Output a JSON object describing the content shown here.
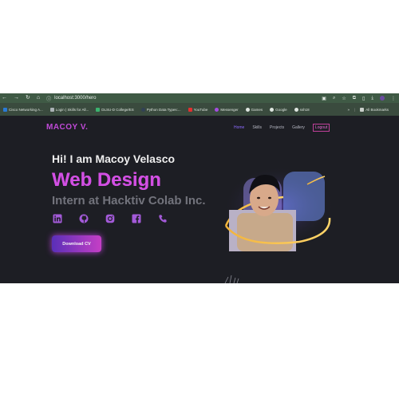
{
  "browser": {
    "url": "localhost:3000/hero",
    "bookmarks": [
      {
        "label": "Cisco Networking A...",
        "color": "#2a7bd6"
      },
      {
        "label": "Login | Skills for All...",
        "color": "#aab1b4"
      },
      {
        "label": "DLSU-D College/ES",
        "color": "#3bb36f"
      },
      {
        "label": "Python Data Types:...",
        "color": "#314155"
      },
      {
        "label": "YouTube",
        "color": "#e23030"
      },
      {
        "label": "Messenger",
        "color": "#a54de0"
      },
      {
        "label": "Games",
        "color": "#dfe6e0"
      },
      {
        "label": "Google",
        "color": "#dfe6e0"
      },
      {
        "label": "ssh18",
        "color": "#dfe6e0"
      }
    ],
    "all_bookmarks": "All Bookmarks",
    "more": "»"
  },
  "site": {
    "logo": "MACOY V.",
    "nav": [
      "Home",
      "Skills",
      "Projects",
      "Gallery",
      "Logout"
    ],
    "greeting": "Hi! I am Macoy Velasco",
    "role": "Web Design",
    "subtitle": "Intern at Hacktiv Colab Inc.",
    "cv_button": "Download CV",
    "socials": [
      "linkedin-icon",
      "github-icon",
      "instagram-icon",
      "facebook-icon",
      "phone-icon"
    ]
  },
  "colors": {
    "accent": "#c04ad8",
    "background": "#1d1e24",
    "nav_active": "#8d6bff"
  }
}
